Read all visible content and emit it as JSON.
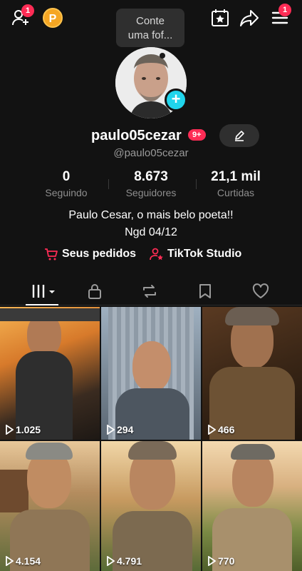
{
  "topbar": {
    "add_friend_badge": "1",
    "coin_label": "P",
    "menu_badge": "1",
    "icons": [
      "add-friend-icon",
      "coin-icon",
      "calendar-star-icon",
      "share-icon",
      "menu-icon"
    ]
  },
  "tooltip": {
    "text_line1": "Conte",
    "text_line2": "uma fof..."
  },
  "profile": {
    "username": "paulo05cezar",
    "notification_badge": "9+",
    "handle": "@paulo05cezar"
  },
  "stats": [
    {
      "value": "0",
      "label": "Seguindo"
    },
    {
      "value": "8.673",
      "label": "Seguidores"
    },
    {
      "value": "21,1 mil",
      "label": "Curtidas"
    }
  ],
  "bio": {
    "line1": "Paulo Cesar, o mais belo poeta!!",
    "line2": "Ngd 04/12"
  },
  "links": {
    "orders": "Seus pedidos",
    "studio": "TikTok Studio"
  },
  "tabs": [
    "videos-tab",
    "private-tab",
    "reposts-tab",
    "favorites-tab",
    "liked-tab"
  ],
  "videos": [
    {
      "views": "1.025"
    },
    {
      "views": "294"
    },
    {
      "views": "466"
    },
    {
      "views": "4.154"
    },
    {
      "views": "4.791"
    },
    {
      "views": "770"
    }
  ],
  "colors": {
    "background": "#121212",
    "accent": "#fe2c55",
    "cyan": "#20d5ec"
  }
}
